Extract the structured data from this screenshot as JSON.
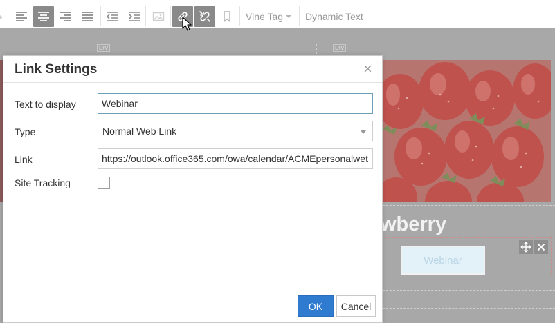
{
  "toolbar": {
    "vine_tag_label": "Vine Tag",
    "dynamic_text_label": "Dynamic Text"
  },
  "canvas": {
    "div_tag": "DIV",
    "heading_partial": "wberry",
    "button_label": "Webinar"
  },
  "dialog": {
    "title": "Link Settings",
    "close_glyph": "×",
    "fields": {
      "text_label": "Text to display",
      "text_value": "Webinar",
      "type_label": "Type",
      "type_value": "Normal Web Link",
      "link_label": "Link",
      "link_value": "https://outlook.office365.com/owa/calendar/ACMEpersonalwet",
      "tracking_label": "Site Tracking"
    },
    "ok_label": "OK",
    "cancel_label": "Cancel"
  },
  "colors": {
    "accent": "#2f7bd0",
    "active_tool": "#8a8a8a"
  }
}
